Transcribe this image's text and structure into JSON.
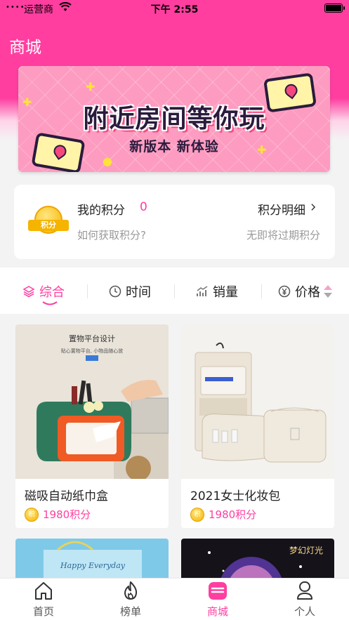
{
  "status_bar": {
    "signal": "••••",
    "carrier": "运营商",
    "time": "下午 2:55"
  },
  "header": {
    "title": "商城"
  },
  "banner": {
    "title": "附近房间等你玩",
    "subtitle": "新版本 新体验"
  },
  "points": {
    "badge_text": "积分",
    "label": "我的积分",
    "value": "0",
    "how_to": "如何获取积分?",
    "detail_link": "积分明细",
    "expire_note": "无即将过期积分"
  },
  "sort": {
    "items": [
      {
        "label": "综合",
        "icon": "layers-icon",
        "active": true
      },
      {
        "label": "时间",
        "icon": "clock-icon",
        "active": false
      },
      {
        "label": "销量",
        "icon": "trend-icon",
        "active": false
      },
      {
        "label": "价格",
        "icon": "yen-icon",
        "active": false
      }
    ]
  },
  "products": [
    {
      "name": "磁吸自动纸巾盒",
      "price": "1980积分",
      "image_caption": "置物平台设计",
      "image_sub": "贴心置物平台, 小物品随心放"
    },
    {
      "name": "2021女士化妆包",
      "price": "1980积分"
    },
    {
      "image_text": "Happy Everyday"
    },
    {
      "image_text": "梦幻灯光"
    }
  ],
  "coin_text": "积",
  "tab_bar": {
    "items": [
      {
        "label": "首页",
        "icon": "home-icon",
        "active": false
      },
      {
        "label": "榜单",
        "icon": "flame-icon",
        "active": false
      },
      {
        "label": "商城",
        "icon": "shop-icon",
        "active": true
      },
      {
        "label": "个人",
        "icon": "person-icon",
        "active": false
      }
    ]
  },
  "colors": {
    "accent": "#ff3ea0",
    "coin": "#f5b400"
  }
}
